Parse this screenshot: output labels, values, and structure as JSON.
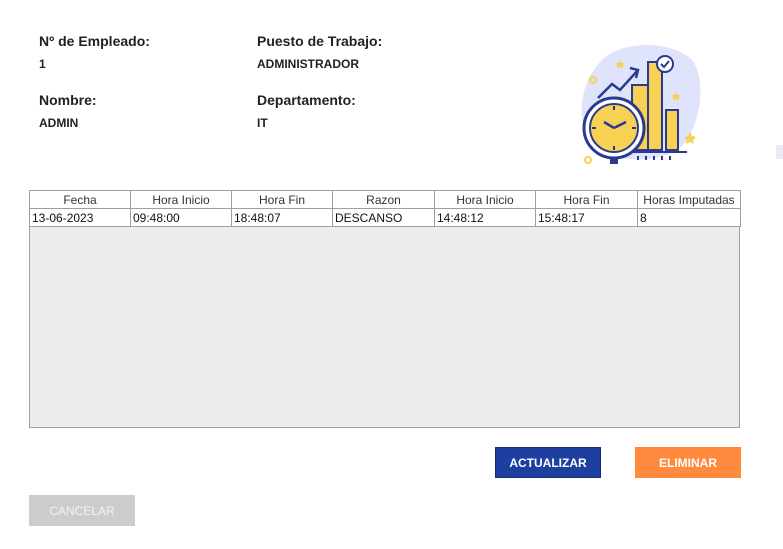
{
  "employee": {
    "number_label": "Nº de Empleado:",
    "number_value": "1",
    "position_label": "Puesto de Trabajo:",
    "position_value": "ADMINISTRADOR",
    "name_label": "Nombre:",
    "name_value": "ADMIN",
    "department_label": "Departamento:",
    "department_value": "IT"
  },
  "illustration": {
    "icon": "time-chart-illustration",
    "colors": {
      "blue": "#2b3a8f",
      "yellow": "#f7d154",
      "light": "#dfe3fb"
    }
  },
  "table": {
    "headers": [
      "Fecha",
      "Hora Inicio",
      "Hora Fin",
      "Razon",
      "Hora Inicio",
      "Hora Fin",
      "Horas Imputadas"
    ],
    "rows": [
      [
        "13-06-2023",
        "09:48:00",
        "18:48:07",
        "DESCANSO",
        "14:48:12",
        "15:48:17",
        "8"
      ]
    ]
  },
  "buttons": {
    "update_label": "ACTUALIZAR",
    "delete_label": "ELIMINAR",
    "cancel_label": "CANCELAR"
  },
  "colors": {
    "update": "#1f3fa0",
    "delete": "#ff8a3d",
    "cancel": "#cccccc"
  }
}
